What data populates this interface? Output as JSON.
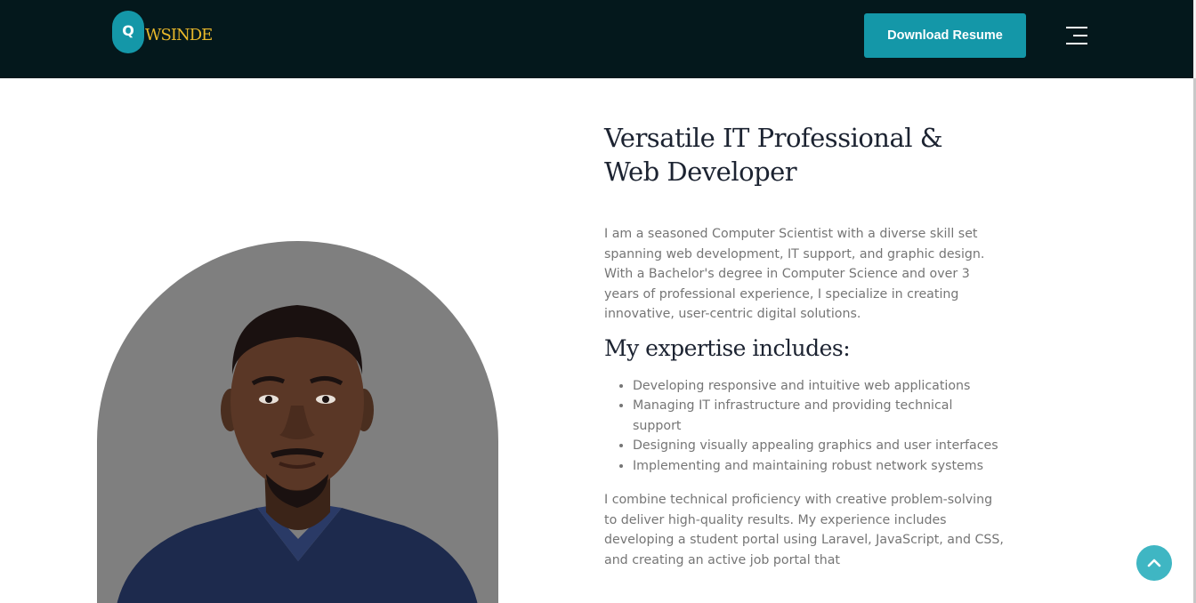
{
  "header": {
    "logo_letter": "Q",
    "logo_text": "WSINDE",
    "download_label": "Download Resume",
    "menu_icon": "hamburger-menu-icon",
    "colors": {
      "navbar": "#04181c",
      "accent": "#1497a8",
      "logo_text": "#e9b82a"
    }
  },
  "portrait": {
    "icon": "profile-photo",
    "background": "#7f7f7f"
  },
  "about": {
    "title": "Versatile IT Professional & Web Developer",
    "intro": "I am a seasoned Computer Scientist with a diverse skill set spanning web development, IT support, and graphic design. With a Bachelor's degree in Computer Science and over 3 years of professional experience, I specialize in creating innovative, user-centric digital solutions.",
    "expertise_heading": "My expertise includes:",
    "expertise": [
      "Developing responsive and intuitive web applications",
      "Managing IT infrastructure and providing technical support",
      "Designing visually appealing graphics and user interfaces",
      "Implementing and maintaining robust network systems"
    ],
    "closing": "I combine technical proficiency with creative problem-solving to deliver high-quality results. My experience includes developing a student portal using Laravel, JavaScript, and CSS, and creating an active job portal that"
  },
  "scroll_top": {
    "icon": "chevron-up-icon"
  }
}
